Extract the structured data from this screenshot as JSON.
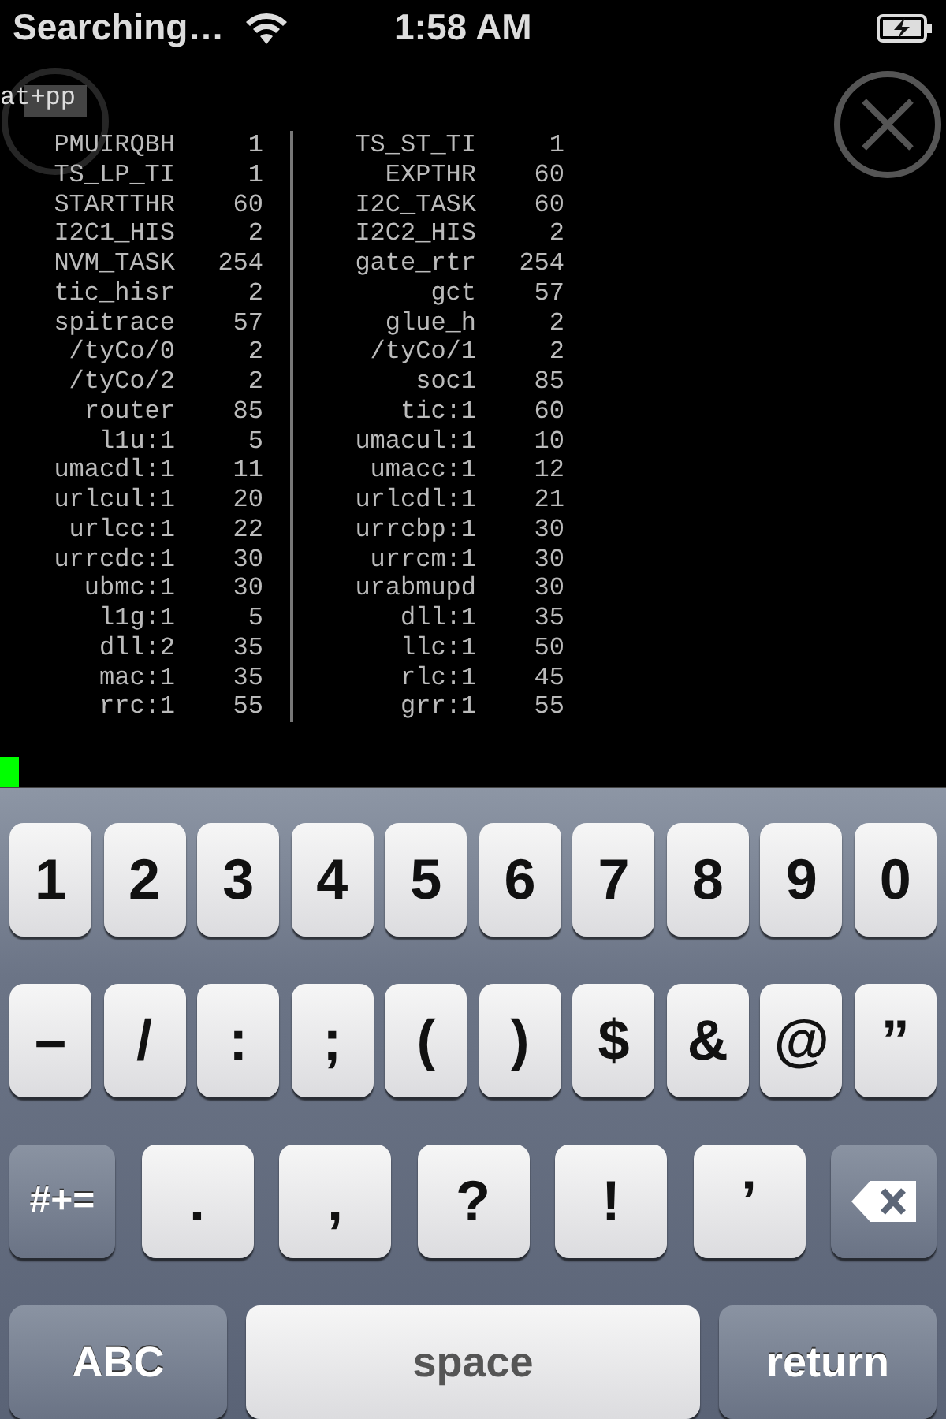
{
  "status_bar": {
    "carrier": "Searching…",
    "time": "1:58 AM",
    "charging": true
  },
  "terminal": {
    "command": "at+pp",
    "rows": [
      {
        "left_name": "PMUIRQBH",
        "left_value": "1",
        "right_name": "TS_ST_TI",
        "right_value": "1"
      },
      {
        "left_name": "TS_LP_TI",
        "left_value": "1",
        "right_name": "EXPTHR",
        "right_value": "60"
      },
      {
        "left_name": "STARTTHR",
        "left_value": "60",
        "right_name": "I2C_TASK",
        "right_value": "60"
      },
      {
        "left_name": "I2C1_HIS",
        "left_value": "2",
        "right_name": "I2C2_HIS",
        "right_value": "2"
      },
      {
        "left_name": "NVM_TASK",
        "left_value": "254",
        "right_name": "gate_rtr",
        "right_value": "254"
      },
      {
        "left_name": "tic_hisr",
        "left_value": "2",
        "right_name": "gct",
        "right_value": "57"
      },
      {
        "left_name": "spitrace",
        "left_value": "57",
        "right_name": "glue_h",
        "right_value": "2"
      },
      {
        "left_name": "/tyCo/0",
        "left_value": "2",
        "right_name": "/tyCo/1",
        "right_value": "2"
      },
      {
        "left_name": "/tyCo/2",
        "left_value": "2",
        "right_name": "soc1",
        "right_value": "85"
      },
      {
        "left_name": "router",
        "left_value": "85",
        "right_name": "tic:1",
        "right_value": "60"
      },
      {
        "left_name": "l1u:1",
        "left_value": "5",
        "right_name": "umacul:1",
        "right_value": "10"
      },
      {
        "left_name": "umacdl:1",
        "left_value": "11",
        "right_name": "umacc:1",
        "right_value": "12"
      },
      {
        "left_name": "urlcul:1",
        "left_value": "20",
        "right_name": "urlcdl:1",
        "right_value": "21"
      },
      {
        "left_name": "urlcc:1",
        "left_value": "22",
        "right_name": "urrcbp:1",
        "right_value": "30"
      },
      {
        "left_name": "urrcdc:1",
        "left_value": "30",
        "right_name": "urrcm:1",
        "right_value": "30"
      },
      {
        "left_name": "ubmc:1",
        "left_value": "30",
        "right_name": "urabmupd",
        "right_value": "30"
      },
      {
        "left_name": "l1g:1",
        "left_value": "5",
        "right_name": "dll:1",
        "right_value": "35"
      },
      {
        "left_name": "dll:2",
        "left_value": "35",
        "right_name": "llc:1",
        "right_value": "50"
      },
      {
        "left_name": "mac:1",
        "left_value": "35",
        "right_name": "rlc:1",
        "right_value": "45"
      },
      {
        "left_name": "rrc:1",
        "left_value": "55",
        "right_name": "grr:1",
        "right_value": "55"
      }
    ]
  },
  "keyboard": {
    "rows": [
      {
        "keys": [
          {
            "label": "1",
            "kind": "char"
          },
          {
            "label": "2",
            "kind": "char"
          },
          {
            "label": "3",
            "kind": "char"
          },
          {
            "label": "4",
            "kind": "char"
          },
          {
            "label": "5",
            "kind": "char"
          },
          {
            "label": "6",
            "kind": "char"
          },
          {
            "label": "7",
            "kind": "char"
          },
          {
            "label": "8",
            "kind": "char"
          },
          {
            "label": "9",
            "kind": "char"
          },
          {
            "label": "0",
            "kind": "char"
          }
        ]
      },
      {
        "keys": [
          {
            "label": "–",
            "kind": "char"
          },
          {
            "label": "/",
            "kind": "char"
          },
          {
            "label": ":",
            "kind": "char"
          },
          {
            "label": ";",
            "kind": "char"
          },
          {
            "label": "(",
            "kind": "char"
          },
          {
            "label": ")",
            "kind": "char"
          },
          {
            "label": "$",
            "kind": "char"
          },
          {
            "label": "&",
            "kind": "char"
          },
          {
            "label": "@",
            "kind": "char"
          },
          {
            "label": "”",
            "kind": "char"
          }
        ]
      },
      {
        "keys": [
          {
            "label": "#+=",
            "kind": "function"
          },
          {
            "label": ".",
            "kind": "wide"
          },
          {
            "label": ",",
            "kind": "wide"
          },
          {
            "label": "?",
            "kind": "wide"
          },
          {
            "label": "!",
            "kind": "wide"
          },
          {
            "label": "’",
            "kind": "wide"
          },
          {
            "kind": "delete"
          }
        ]
      },
      {
        "keys": [
          {
            "label": "ABC",
            "kind": "function"
          },
          {
            "label": "space",
            "kind": "space"
          },
          {
            "label": "return",
            "kind": "function"
          }
        ]
      }
    ]
  }
}
